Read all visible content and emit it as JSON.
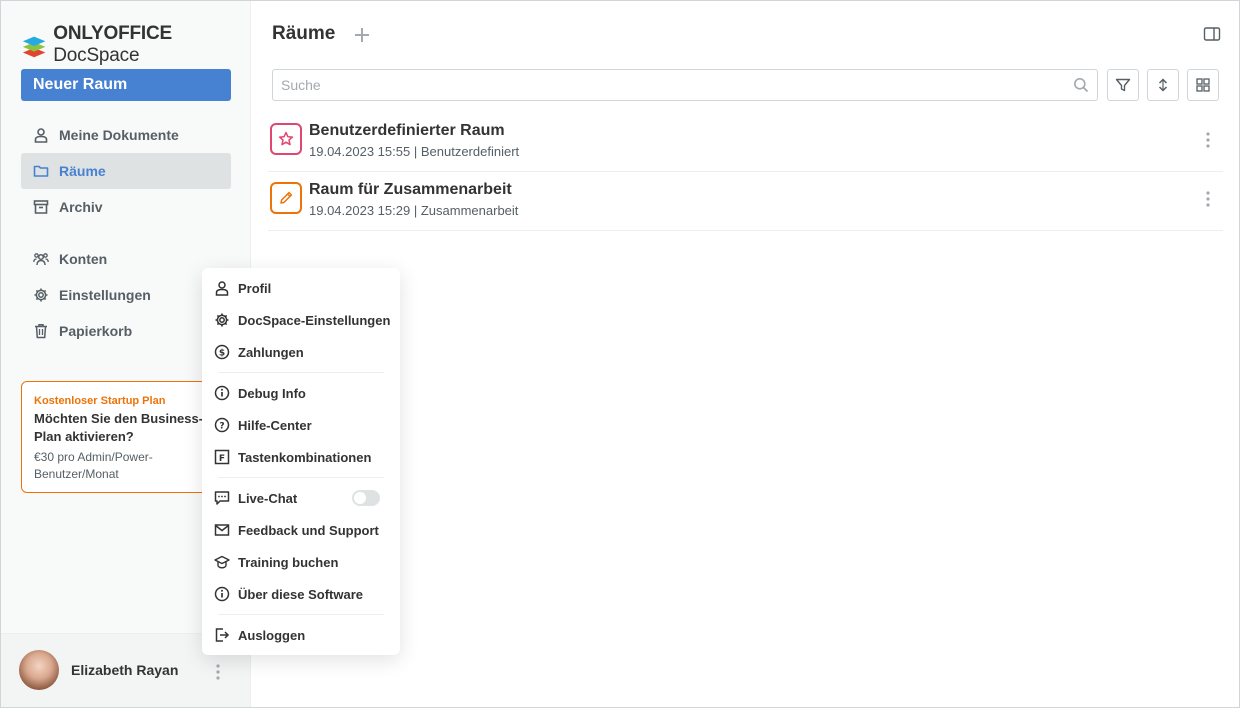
{
  "app": {
    "logo_brand": "ONLYOFFICE",
    "logo_product": "DocSpace",
    "accent_color": "#4781d1"
  },
  "sidebar": {
    "new_room_label": "Neuer Raum",
    "items": [
      {
        "label": "Meine Dokumente",
        "icon": "person-icon"
      },
      {
        "label": "Räume",
        "icon": "folder-icon",
        "active": true
      },
      {
        "label": "Archiv",
        "icon": "archive-icon"
      },
      {
        "label": "Konten",
        "icon": "accounts-icon"
      },
      {
        "label": "Einstellungen",
        "icon": "gear-icon"
      },
      {
        "label": "Papierkorb",
        "icon": "trash-icon"
      }
    ],
    "promo": {
      "title": "Kostenloser Startup Plan",
      "headline": "Möchten Sie den Business-Plan aktivieren?",
      "text": "€30 pro Admin/Power-Benutzer/Monat",
      "color": "#ed7309"
    },
    "user": {
      "name": "Elizabeth Rayan"
    }
  },
  "main": {
    "title": "Räume",
    "search_placeholder": "Suche",
    "rooms": [
      {
        "title": "Benutzerdefinierter Raum",
        "date": "19.04.2023 15:55",
        "type": "Benutzerdefiniert",
        "icon": "star-icon",
        "color": "#e0466f"
      },
      {
        "title": "Raum für Zusammenarbeit",
        "date": "19.04.2023 15:29",
        "type": "Zusammenarbeit",
        "icon": "pencil-icon",
        "color": "#ed7309"
      }
    ],
    "meta_separator": "|"
  },
  "menu": {
    "items": [
      {
        "label": "Profil",
        "icon": "person-icon"
      },
      {
        "label": "DocSpace-Einstellungen",
        "icon": "gear-icon"
      },
      {
        "label": "Zahlungen",
        "icon": "payment-icon"
      },
      {
        "label": "Debug Info",
        "icon": "info-icon"
      },
      {
        "label": "Hilfe-Center",
        "icon": "help-icon"
      },
      {
        "label": "Tastenkombinationen",
        "icon": "hotkeys-icon"
      },
      {
        "label": "Live-Chat",
        "icon": "chat-icon",
        "toggle": false
      },
      {
        "label": "Feedback und Support",
        "icon": "mail-icon"
      },
      {
        "label": "Training buchen",
        "icon": "graduation-icon"
      },
      {
        "label": "Über diese Software",
        "icon": "info-icon"
      },
      {
        "label": "Ausloggen",
        "icon": "logout-icon"
      }
    ]
  }
}
